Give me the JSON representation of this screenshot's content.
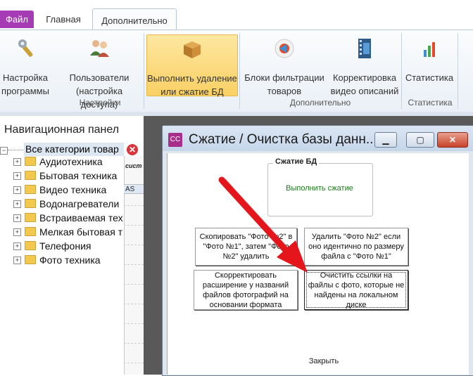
{
  "ribbon": {
    "tabs": {
      "file": "Файл",
      "home": "Главная",
      "extra": "Дополнительно"
    },
    "buttons": {
      "settings": "Настройка программы",
      "users": "Пользователи (настройка доступа)",
      "compress": "Выполнить удаление или сжатие БД",
      "filters": "Блоки фильтрации товаров",
      "video": "Корректировка видео описаний",
      "stats": "Статистика"
    },
    "groups": {
      "settings": "Настройки",
      "extra": "Дополнительно",
      "stats": "Статистика"
    }
  },
  "nav": {
    "title": "Навигационная панел",
    "root": "Все категории товар",
    "items": [
      "Аудиотехника",
      "Бытовая техника",
      "Видео техника",
      "Водонагреватели",
      "Встраиваемая тех",
      "Мелкая бытовая т",
      "Телефония",
      "Фото техника"
    ]
  },
  "sheet": {
    "header": "сист",
    "cell": "AS"
  },
  "dialog": {
    "icon_text": "CC",
    "title": "Сжатие / Очистка базы данн...",
    "compress_group": "Сжатие БД",
    "compress_button": "Выполнить сжатие",
    "buttons": {
      "copy": "Скопировать \"Фото №2\" в \"Фото №1\", затем \"Фото №2\" удалить",
      "delete_duplicate": "Удалить \"Фото №2\" если оно идентично по размеру файла с \"Фото №1\"",
      "fix_extension": "Скорректировать расширение у названий файлов фотографий на основании формата",
      "clear_links": "Очистить ссылки на файлы с фото, которые не найдены на локальном диске"
    },
    "close": "Закрыть"
  },
  "colors": {
    "accent_file_tab": "#a63bb5",
    "arrow": "#e5161b",
    "compress_text": "#1f7a1f"
  }
}
